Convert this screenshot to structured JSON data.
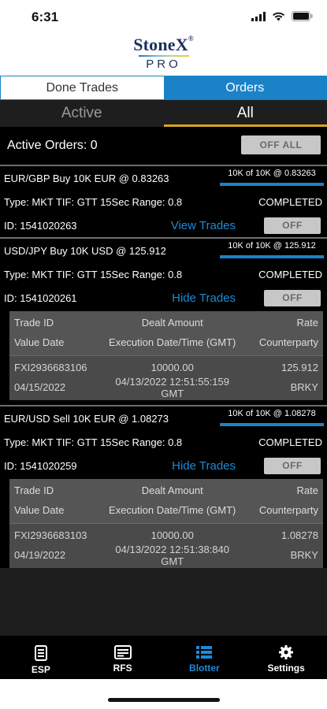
{
  "status_bar": {
    "time": "6:31"
  },
  "logo": {
    "brand": "StoneX",
    "brand_mark": "®",
    "sub": "PRO"
  },
  "top_tabs": [
    {
      "label": "Done Trades",
      "selected": false
    },
    {
      "label": "Orders",
      "selected": true
    }
  ],
  "sub_tabs": [
    {
      "label": "Active",
      "selected": false
    },
    {
      "label": "All",
      "selected": true
    }
  ],
  "summary": {
    "label": "Active Orders: 0",
    "off_all_label": "OFF ALL"
  },
  "orders": [
    {
      "heading": "EUR/GBP Buy 10K EUR @ 0.83263",
      "fill_text": "10K of 10K @ 0.83263",
      "fill_fraction": 1.0,
      "info": "Type: MKT TIF: GTT 15Sec Range: 0.8",
      "status": "COMPLETED",
      "id": "ID: 1541020263",
      "link": "View Trades",
      "off_label": "OFF",
      "trades": null
    },
    {
      "heading": "USD/JPY Buy 10K USD @ 125.912",
      "fill_text": "10K of 10K @ 125.912",
      "fill_fraction": 1.0,
      "info": "Type: MKT TIF: GTT 15Sec Range: 0.8",
      "status": "COMPLETED",
      "id": "ID: 1541020261",
      "link": "Hide Trades",
      "off_label": "OFF",
      "trades": {
        "header1": [
          "Trade ID",
          "Dealt Amount",
          "Rate"
        ],
        "header2": [
          "Value Date",
          "Execution Date/Time (GMT)",
          "Counterparty"
        ],
        "row1": [
          "FXI2936683106",
          "10000.00",
          "125.912"
        ],
        "row2": [
          "04/15/2022",
          "04/13/2022 12:51:55:159 GMT",
          "BRKY"
        ]
      }
    },
    {
      "heading": "EUR/USD Sell 10K EUR @ 1.08273",
      "fill_text": "10K of 10K @ 1.08278",
      "fill_fraction": 1.0,
      "info": "Type: MKT TIF: GTT 15Sec Range: 0.8",
      "status": "COMPLETED",
      "id": "ID: 1541020259",
      "link": "Hide Trades",
      "off_label": "OFF",
      "trades": {
        "header1": [
          "Trade ID",
          "Dealt Amount",
          "Rate"
        ],
        "header2": [
          "Value Date",
          "Execution Date/Time (GMT)",
          "Counterparty"
        ],
        "row1": [
          "FXI2936683103",
          "10000.00",
          "1.08278"
        ],
        "row2": [
          "04/19/2022",
          "04/13/2022 12:51:38:840 GMT",
          "BRKY"
        ]
      }
    }
  ],
  "tab_bar": [
    {
      "label": "ESP",
      "icon": "esp-icon",
      "selected": false
    },
    {
      "label": "RFS",
      "icon": "rfs-icon",
      "selected": false
    },
    {
      "label": "Blotter",
      "icon": "blotter-icon",
      "selected": true
    },
    {
      "label": "Settings",
      "icon": "gear-icon",
      "selected": false
    }
  ],
  "colors": {
    "accent": "#1b82c8",
    "tab_underline": "#d7a520",
    "link": "#1b8bd8"
  }
}
